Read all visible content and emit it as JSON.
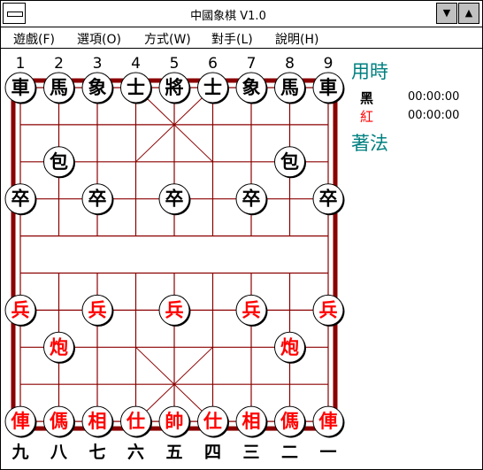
{
  "window": {
    "title": "中國象棋 V1.0"
  },
  "title_buttons": {
    "minimize": "▼",
    "maximize": "▲"
  },
  "menu": [
    {
      "id": "game",
      "label": "遊戲(F)"
    },
    {
      "id": "options",
      "label": "選項(O)"
    },
    {
      "id": "mode",
      "label": "方式(W)"
    },
    {
      "id": "opponent",
      "label": "對手(L)"
    },
    {
      "id": "help",
      "label": "說明(H)"
    }
  ],
  "board": {
    "top_numbers": [
      "1",
      "2",
      "3",
      "4",
      "5",
      "6",
      "7",
      "8",
      "9"
    ],
    "bottom_numbers": [
      "九",
      "八",
      "七",
      "六",
      "五",
      "四",
      "三",
      "二",
      "一"
    ],
    "black_color": "#000000",
    "red_color": "#ff0000",
    "line_color": "#8b0000",
    "pieces": [
      {
        "col": 0,
        "row": 0,
        "side": "black",
        "label": "車"
      },
      {
        "col": 1,
        "row": 0,
        "side": "black",
        "label": "馬"
      },
      {
        "col": 2,
        "row": 0,
        "side": "black",
        "label": "象"
      },
      {
        "col": 3,
        "row": 0,
        "side": "black",
        "label": "士"
      },
      {
        "col": 4,
        "row": 0,
        "side": "black",
        "label": "將"
      },
      {
        "col": 5,
        "row": 0,
        "side": "black",
        "label": "士"
      },
      {
        "col": 6,
        "row": 0,
        "side": "black",
        "label": "象"
      },
      {
        "col": 7,
        "row": 0,
        "side": "black",
        "label": "馬"
      },
      {
        "col": 8,
        "row": 0,
        "side": "black",
        "label": "車"
      },
      {
        "col": 1,
        "row": 2,
        "side": "black",
        "label": "包"
      },
      {
        "col": 7,
        "row": 2,
        "side": "black",
        "label": "包"
      },
      {
        "col": 0,
        "row": 3,
        "side": "black",
        "label": "卒"
      },
      {
        "col": 2,
        "row": 3,
        "side": "black",
        "label": "卒"
      },
      {
        "col": 4,
        "row": 3,
        "side": "black",
        "label": "卒"
      },
      {
        "col": 6,
        "row": 3,
        "side": "black",
        "label": "卒"
      },
      {
        "col": 8,
        "row": 3,
        "side": "black",
        "label": "卒"
      },
      {
        "col": 0,
        "row": 6,
        "side": "red",
        "label": "兵"
      },
      {
        "col": 2,
        "row": 6,
        "side": "red",
        "label": "兵"
      },
      {
        "col": 4,
        "row": 6,
        "side": "red",
        "label": "兵"
      },
      {
        "col": 6,
        "row": 6,
        "side": "red",
        "label": "兵"
      },
      {
        "col": 8,
        "row": 6,
        "side": "red",
        "label": "兵"
      },
      {
        "col": 1,
        "row": 7,
        "side": "red",
        "label": "炮"
      },
      {
        "col": 7,
        "row": 7,
        "side": "red",
        "label": "炮"
      },
      {
        "col": 0,
        "row": 9,
        "side": "red",
        "label": "俥"
      },
      {
        "col": 1,
        "row": 9,
        "side": "red",
        "label": "傌"
      },
      {
        "col": 2,
        "row": 9,
        "side": "red",
        "label": "相"
      },
      {
        "col": 3,
        "row": 9,
        "side": "red",
        "label": "仕"
      },
      {
        "col": 4,
        "row": 9,
        "side": "red",
        "label": "帥"
      },
      {
        "col": 5,
        "row": 9,
        "side": "red",
        "label": "仕"
      },
      {
        "col": 6,
        "row": 9,
        "side": "red",
        "label": "相"
      },
      {
        "col": 7,
        "row": 9,
        "side": "red",
        "label": "傌"
      },
      {
        "col": 8,
        "row": 9,
        "side": "red",
        "label": "俥"
      }
    ]
  },
  "side_panel": {
    "time_heading": "用時",
    "black_label": "黑",
    "black_time": "00:00:00",
    "red_label": "紅",
    "red_time": "00:00:00",
    "moves_heading": "著法",
    "heading_color": "#008080"
  }
}
